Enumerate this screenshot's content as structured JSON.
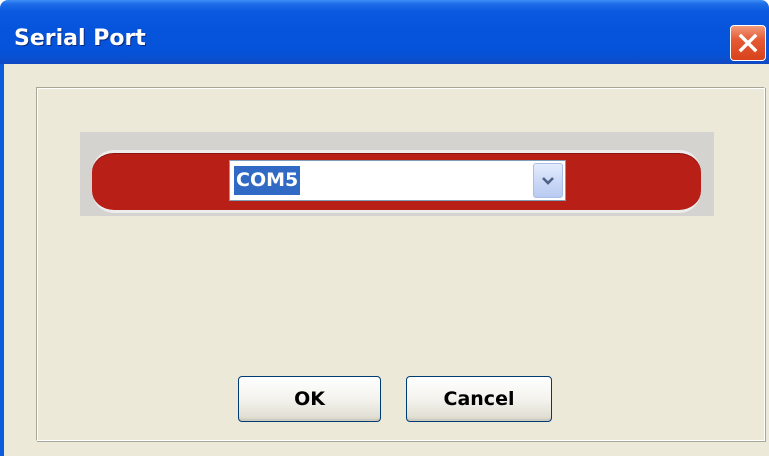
{
  "window": {
    "title": "Serial Port",
    "close_icon": "close-icon"
  },
  "port_select": {
    "selected_value": "COM5",
    "dropdown_icon": "chevron-down-icon"
  },
  "buttons": {
    "ok_label": "OK",
    "cancel_label": "Cancel"
  },
  "colors": {
    "titlebar_blue": "#0654dc",
    "dialog_background": "#ece9d8",
    "panel_red": "#b71f17",
    "selection_blue": "#316ac5",
    "close_button_red": "#d8421b"
  }
}
